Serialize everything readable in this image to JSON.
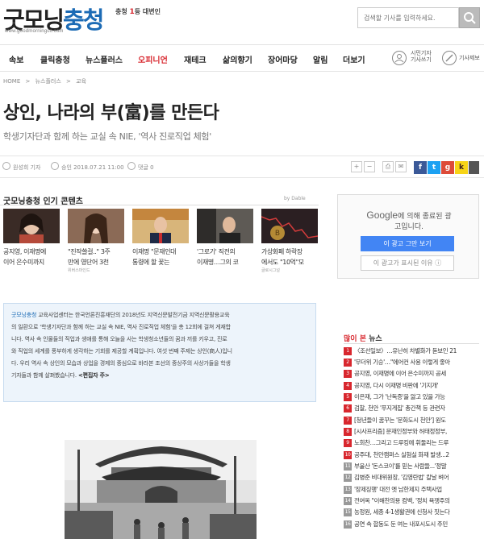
{
  "header": {
    "logo_main": "굿모닝",
    "logo_accent": "충청",
    "logo_url": "www.goodmorningcc.com",
    "tagline_pre": "충청 ",
    "tagline_num": "1",
    "tagline_post": "등 대변인",
    "search_placeholder": "검색할 기사를 입력하세요."
  },
  "nav": {
    "items": [
      "속보",
      "클릭충청",
      "뉴스플러스",
      "오피니언",
      "재테크",
      "삶의향기",
      "장어마당",
      "알림",
      "더보기"
    ],
    "active_index": 3,
    "reporter_label_1": "시민기자",
    "reporter_label_2": "기사쓰기",
    "submit_label": "기사제보"
  },
  "breadcrumb": [
    "HOME",
    ">",
    "뉴스플러스",
    ">",
    "교육"
  ],
  "article": {
    "title": "상인, 나라의 부(富)를 만든다",
    "subtitle": "학생기자단과 함께 하는 교실 속 NIE, '역사 진로직업 체험'",
    "author": "원성희 기자",
    "date": "승인 2018.07.21 11:00",
    "comments": "댓글 0"
  },
  "tools": [
    "+",
    "−",
    "⎙",
    "✉"
  ],
  "sns": [
    "f",
    "t",
    "g",
    "k",
    ""
  ],
  "sns_colors": [
    "#3b5998",
    "#1da1f2",
    "#dd4b39",
    "#f7d417",
    "#8bc34a",
    "#555555"
  ],
  "popular": {
    "title": "굿모닝충청 인기 콘텐츠",
    "by": "by Dable",
    "cards": [
      {
        "line1": "공지영, 이재명에",
        "line2": "이어 은수미까지",
        "source": ""
      },
      {
        "line1": "\"진작쓸걸..\" 3주",
        "line2": "만에 영단어 3천",
        "source": "위버스마인드"
      },
      {
        "line1": "이재명 \"문재인대",
        "line2": "통령에 할 꽃는",
        "source": ""
      },
      {
        "line1": "'그로기' 직전의",
        "line2": "이재명…그의 코",
        "source": ""
      },
      {
        "line1": "가상화폐 하락장",
        "line2": "에서도 \"10억\"모",
        "source": "글로시그널"
      }
    ]
  },
  "ad": {
    "google": "Google",
    "text_1": "에 의해 종료된 광",
    "text_2": "고입니다.",
    "stop_button": "이 광고 그만 보기",
    "why_button": "이 광고가 표시된 이유 ⓘ"
  },
  "intro": {
    "brand": "굿모닝충청",
    "line1": " 교육사업센터는 한국언론진흥재단의 2018년도 지역신문발전기금 지역신문활용교육",
    "line2": "의 일환으로 '학생기자단과 함께 하는 교실 속 NIE, 역사 진로직업 체험'을 총 12회에 걸쳐 게재합",
    "line3": "니다. 역사 속 인물들의 직업과 생애를 통해 오늘을 사는 학생청소년들의 꿈과 끼를 키우고, 진로",
    "line4": "와 직업의 세계를 풍부하게 생각하는 기회를 제공할 계획입니다. 여섯 번째 주제는 상인(商人)입니",
    "line5": "다. 우리 역사 속 상인의 모습과 상업을 경제의 중심으로 바라본 조선의 중상주의 사상가들을 학생",
    "line6": "기자들과 함께 살펴봤습니다. ",
    "editor": "<편집자 주>"
  },
  "most_read": {
    "title_red": "많이 본",
    "title_rest": " 뉴스",
    "items": [
      "〈조선일보〉…유난히 차별화가 돋보인 21",
      "'무더위 기승'…\"에어컨 사용 이렇게 좋아",
      "공지영, 이재명에 이어 은수미까지 공세",
      "공지영, 다시 이재명 비판에 '기지개'",
      "이은재, 그가 '난독증'을 앓고 있을 가능",
      "검찰, 천안 '푸지게집' 총간책 등 관련자",
      "[청년들이 꿈꾸는 '문화도시 천안'] 원도",
      "[시사프리즘] 문재인정부와 허태정정부,",
      "노회찬…그리고 드루킹에 휘둘리는 드루",
      "공주대, 천안캠퍼스 실험실 화재 발생...2",
      "부울산 '돈스코이'를 믿는 사람들...'정말",
      "김병준 비대위원장, '김영란법' 칼날 벼어",
      "'장제징행' 대전 옛 남한제지 주택사업",
      "전여옥 \"이해찬의용 컴백, '정치 욕쟁주의",
      "농정원, 세종 4-1생활권에 신청사 짓는다",
      "공연 속 합동도 둔 여는 내포시도시 주민"
    ]
  }
}
